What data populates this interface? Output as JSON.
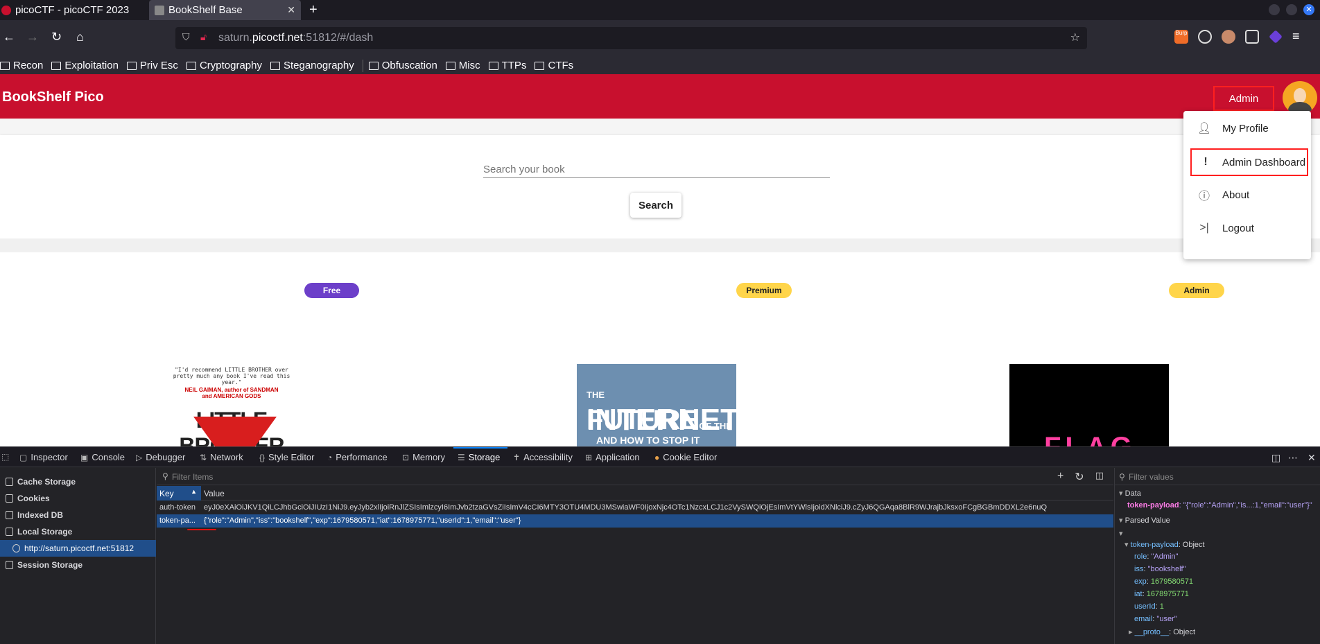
{
  "browser": {
    "tabs": [
      {
        "title": "picoCTF - picoCTF 2023",
        "favicon_color": "#c8102e"
      },
      {
        "title": "BookShelf Base",
        "favicon_color": "#888888"
      }
    ],
    "url_host_prefix": "saturn.",
    "url_host_main": "picoctf.net",
    "url_rest": ":51812/#/dash",
    "bookmarks": [
      "Recon",
      "Exploitation",
      "Priv Esc",
      "Cryptography",
      "Steganography",
      "Obfuscation",
      "Misc",
      "TTPs",
      "CTFs"
    ],
    "burp_badge": "Burp"
  },
  "app": {
    "brand": "BookShelf Pico",
    "admin_button": "Admin",
    "accent_color": "#c8102e",
    "search_placeholder": "Search your book",
    "search_button": "Search",
    "menu": [
      {
        "icon": "person-icon",
        "label": "My Profile"
      },
      {
        "icon": "exclamation-icon",
        "label": "Admin Dashboard"
      },
      {
        "icon": "help-icon",
        "label": "About"
      },
      {
        "icon": "logout-icon",
        "label": "Logout"
      }
    ],
    "books": [
      {
        "badge": "Free",
        "badge_color": "#6c3fc9"
      },
      {
        "badge": "Premium",
        "badge_color": "#ffd54a"
      },
      {
        "badge": "Admin",
        "badge_color": "#ffd54a"
      }
    ],
    "cover1_quote": "\"I'd recommend LITTLE BROTHER over pretty much any book I've read this year.\"",
    "cover1_author": "NEIL GAIMAN, author of SANDMAN and AMERICAN GODS",
    "cover1_title": "LITTLE BROTHER",
    "cover2_line1": "THE",
    "cover2_line1b": "FUTURE",
    "cover2_line1c": "OF THE",
    "cover2_line2": "INTERNET",
    "cover2_line3": "AND HOW TO STOP IT",
    "cover3_title": "FLAG"
  },
  "devtools": {
    "tabs": [
      "Inspector",
      "Console",
      "Debugger",
      "Network",
      "Style Editor",
      "Performance",
      "Memory",
      "Storage",
      "Accessibility",
      "Application",
      "Cookie Editor"
    ],
    "selected_tab": "Storage",
    "sidebar": [
      "Cache Storage",
      "Cookies",
      "Indexed DB",
      "Local Storage",
      "http://saturn.picoctf.net:51812",
      "Session Storage"
    ],
    "filter_items": "Filter Items",
    "filter_values": "Filter values",
    "col_key": "Key",
    "col_value": "Value",
    "rows": [
      {
        "key": "auth-token",
        "value": "eyJ0eXAiOiJKV1QiLCJhbGciOiJIUzI1NiJ9.eyJyb2xlIjoiRnJlZSIsImlzcyI6ImJvb2tzaGVsZiIsImV4cCI6MTY3OTU4MDU3MSwiaWF0IjoxNjc4OTc1NzcxLCJ1c2VySWQiOjEsImVtYWlsIjoidXNlciJ9.cZyJ6QGAqa8BlR9WJrajbJksxoFCgBGBmDDXL2e6nuQ"
      },
      {
        "key": "token-pa...",
        "value": "{\"role\":\"Admin\",\"iss\":\"bookshelf\",\"exp\":1679580571,\"iat\":1678975771,\"userId\":1,\"email\":\"user\"}"
      }
    ],
    "data_header": "Data",
    "data_key": "token-payload",
    "data_value": ": \"{\"role\":\"Admin\",\"is...:1,\"email\":\"user\"}\"",
    "parsed_header": "Parsed Value",
    "parsed_root": "token-payload",
    "parsed_root_type": ": Object",
    "parsed": [
      {
        "k": "role",
        "v": "\"Admin\"",
        "t": "str"
      },
      {
        "k": "iss",
        "v": "\"bookshelf\"",
        "t": "str"
      },
      {
        "k": "exp",
        "v": "1679580571",
        "t": "num"
      },
      {
        "k": "iat",
        "v": "1678975771",
        "t": "num"
      },
      {
        "k": "userId",
        "v": "1",
        "t": "num"
      },
      {
        "k": "email",
        "v": "\"user\"",
        "t": "str"
      }
    ],
    "proto": "__proto__",
    "proto_type": ": Object"
  }
}
